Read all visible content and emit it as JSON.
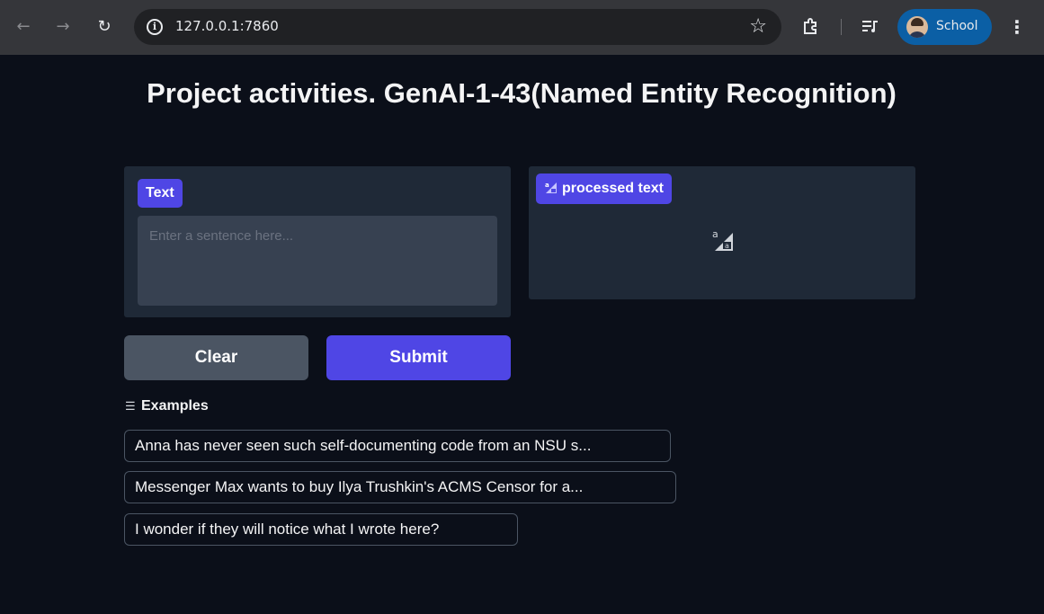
{
  "browser": {
    "url": "127.0.0.1:7860",
    "profile_name": "School"
  },
  "page": {
    "title": "Project activities. GenAI-1-43(Named Entity Recognition)"
  },
  "input_panel": {
    "label": "Text",
    "placeholder": "Enter a sentence here..."
  },
  "output_panel": {
    "label": "processed text"
  },
  "buttons": {
    "clear": "Clear",
    "submit": "Submit"
  },
  "examples": {
    "heading": "Examples",
    "items": [
      "Anna has never seen such self-documenting code from an NSU s...",
      "Messenger Max wants to buy Ilya Trushkin's ACMS Censor for a...",
      "I wonder if they will notice what I wrote here?"
    ]
  },
  "colors": {
    "background": "#0b0f19",
    "panel": "#1f2937",
    "accent": "#4f46e5",
    "secondary_button": "#4b5563"
  }
}
